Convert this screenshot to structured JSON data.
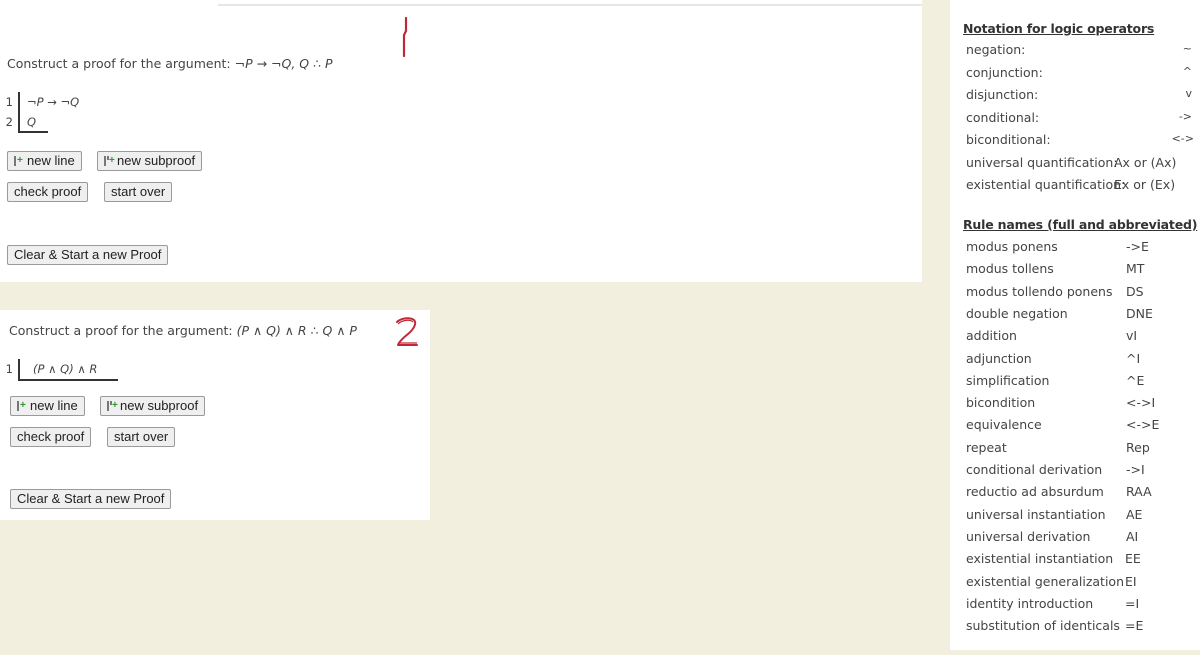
{
  "problems": [
    {
      "number_annotation": "1",
      "prompt_prefix": "Construct a proof for the argument: ",
      "argument": "¬P → ¬Q, Q ∴ P",
      "lines": [
        {
          "num": "1",
          "formula": "¬P → ¬Q"
        },
        {
          "num": "2",
          "formula": "Q"
        }
      ],
      "buttons": {
        "new_line": "new line",
        "new_subproof": "new subproof",
        "check_proof": "check proof",
        "start_over": "start over",
        "clear_start_new": "Clear & Start a new Proof"
      }
    },
    {
      "number_annotation": "2",
      "prompt_prefix": "Construct a proof for the argument: ",
      "argument": "(P ∧ Q) ∧ R ∴ Q ∧ P",
      "lines": [
        {
          "num": "1",
          "formula": "(P ∧ Q) ∧ R"
        }
      ],
      "buttons": {
        "new_line": "new line",
        "new_subproof": "new subproof",
        "check_proof": "check proof",
        "start_over": "start over",
        "clear_start_new": "Clear & Start a new Proof"
      }
    }
  ],
  "sidebar": {
    "notation_title": "Notation for logic operators",
    "notation": [
      {
        "name": "negation:",
        "symbol": "~"
      },
      {
        "name": "conjunction:",
        "symbol": "^"
      },
      {
        "name": "disjunction:",
        "symbol": "v"
      },
      {
        "name": "conditional:",
        "symbol": "->"
      },
      {
        "name": "biconditional:",
        "symbol": "<->"
      },
      {
        "name": "universal quantification:",
        "symbol": "Ax or (Ax)"
      },
      {
        "name": "existential quantification:",
        "symbol": "Ex or (Ex)"
      }
    ],
    "rules_title": "Rule names (full and abbreviated)",
    "rules": [
      {
        "name": "modus ponens",
        "abbr": "->E"
      },
      {
        "name": "modus tollens",
        "abbr": "MT"
      },
      {
        "name": "modus tollendo ponens",
        "abbr": "DS"
      },
      {
        "name": "double negation",
        "abbr": "DNE"
      },
      {
        "name": "addition",
        "abbr": "vI"
      },
      {
        "name": "adjunction",
        "abbr": "^I"
      },
      {
        "name": "simplification",
        "abbr": "^E"
      },
      {
        "name": "bicondition",
        "abbr": "<->I"
      },
      {
        "name": "equivalence",
        "abbr": "<->E"
      },
      {
        "name": "repeat",
        "abbr": "Rep"
      },
      {
        "name": "conditional derivation",
        "abbr": "->I"
      },
      {
        "name": "reductio ad absurdum",
        "abbr": "RAA"
      },
      {
        "name": "universal instantiation",
        "abbr": "AE"
      },
      {
        "name": "universal derivation",
        "abbr": "AI"
      },
      {
        "name": "existential instantiation",
        "abbr": "EE"
      },
      {
        "name": "existential generalization",
        "abbr": "EI"
      },
      {
        "name": "identity introduction",
        "abbr": "=I"
      },
      {
        "name": "substitution of identicals",
        "abbr": "=E"
      }
    ]
  },
  "colors": {
    "background": "#f3efdf",
    "panel": "#ffffff",
    "annotation_red": "#c0283a",
    "plus_green": "#2e9b2e"
  }
}
